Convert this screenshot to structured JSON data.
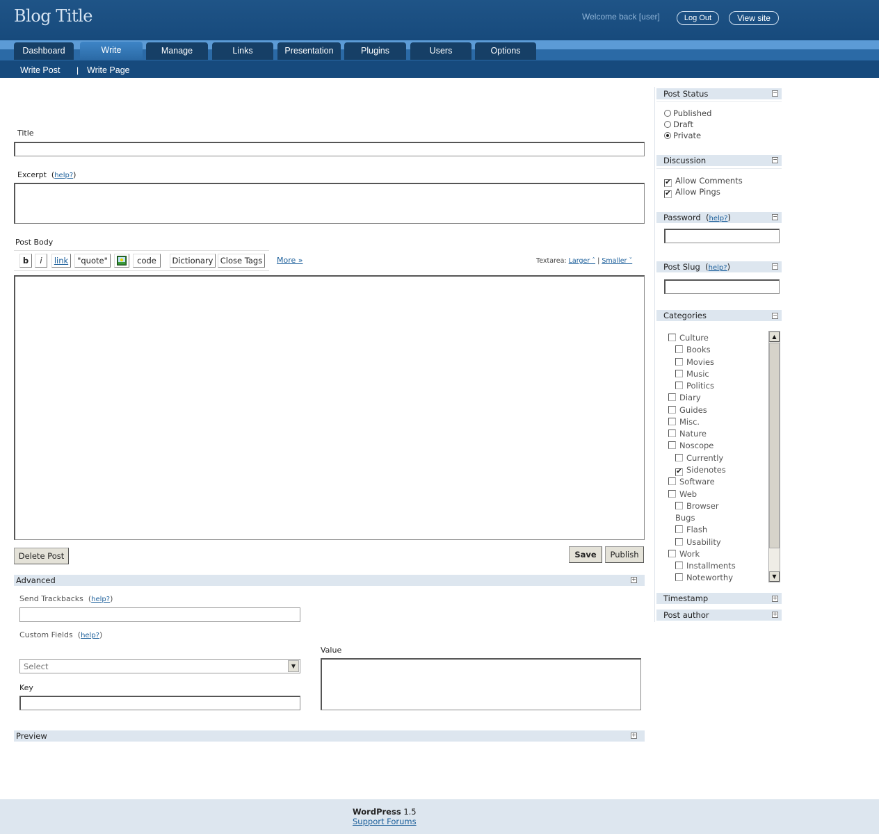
{
  "header": {
    "blog_title": "Blog Title",
    "welcome": "Welcome back [user]",
    "logout": "Log Out",
    "view_site": "View site"
  },
  "tabs": [
    {
      "label": "Dashboard",
      "active": false
    },
    {
      "label": "Write",
      "active": true
    },
    {
      "label": "Manage",
      "active": false
    },
    {
      "label": "Links",
      "active": false
    },
    {
      "label": "Presentation",
      "active": false
    },
    {
      "label": "Plugins",
      "active": false
    },
    {
      "label": "Users",
      "active": false
    },
    {
      "label": "Options",
      "active": false
    }
  ],
  "subtabs": {
    "write_post": "Write Post",
    "separator": "|",
    "write_page": "Write Page"
  },
  "form": {
    "title_label": "Title",
    "title_value": "",
    "excerpt_label": "Excerpt",
    "help": "help?",
    "post_body_label": "Post Body",
    "quicktags": [
      "b",
      "i",
      "link",
      "\"quote\"",
      "code",
      "Dictionary",
      "Close Tags"
    ],
    "image_icon": "image-icon",
    "more": "More »",
    "textarea_label": "Textarea:",
    "larger": "Larger ˆ",
    "smaller": "Smaller ˇ",
    "text_sep": "|",
    "delete_post": "Delete Post",
    "save": "Save",
    "publish": "Publish"
  },
  "advanced": {
    "title": "Advanced",
    "send_trackbacks": "Send Trackbacks",
    "custom_fields": "Custom Fields",
    "select_placeholder": "Select",
    "key": "Key",
    "value": "Value"
  },
  "preview": {
    "title": "Preview"
  },
  "sidebar": {
    "post_status": {
      "title": "Post Status",
      "options": [
        {
          "label": "Published",
          "checked": false
        },
        {
          "label": "Draft",
          "checked": false
        },
        {
          "label": "Private",
          "checked": true
        }
      ]
    },
    "discussion": {
      "title": "Discussion",
      "options": [
        {
          "label": "Allow Comments",
          "checked": true
        },
        {
          "label": "Allow Pings",
          "checked": true
        }
      ]
    },
    "password": {
      "title": "Password",
      "value": ""
    },
    "post_slug": {
      "title": "Post Slug",
      "value": ""
    },
    "categories": {
      "title": "Categories",
      "items": [
        {
          "label": "Culture",
          "level": 0,
          "checked": false,
          "checkbox": true
        },
        {
          "label": "Books",
          "level": 1,
          "checked": false,
          "checkbox": true
        },
        {
          "label": "Movies",
          "level": 1,
          "checked": false,
          "checkbox": true
        },
        {
          "label": "Music",
          "level": 1,
          "checked": false,
          "checkbox": true
        },
        {
          "label": "Politics",
          "level": 1,
          "checked": false,
          "checkbox": true
        },
        {
          "label": "Diary",
          "level": 0,
          "checked": false,
          "checkbox": true
        },
        {
          "label": "Guides",
          "level": 0,
          "checked": false,
          "checkbox": true
        },
        {
          "label": "Misc.",
          "level": 0,
          "checked": false,
          "checkbox": true
        },
        {
          "label": "Nature",
          "level": 0,
          "checked": false,
          "checkbox": true
        },
        {
          "label": "Noscope",
          "level": 0,
          "checked": false,
          "checkbox": true
        },
        {
          "label": "Currently",
          "level": 1,
          "checked": false,
          "checkbox": true
        },
        {
          "label": "Sidenotes",
          "level": 1,
          "checked": true,
          "checkbox": true
        },
        {
          "label": "Software",
          "level": 0,
          "checked": false,
          "checkbox": true
        },
        {
          "label": "Web",
          "level": 0,
          "checked": false,
          "checkbox": true
        },
        {
          "label": "Browser",
          "level": 1,
          "checked": false,
          "checkbox": true
        },
        {
          "label": "Bugs",
          "level": 1,
          "checked": false,
          "checkbox": false
        },
        {
          "label": "Flash",
          "level": 1,
          "checked": false,
          "checkbox": true
        },
        {
          "label": "Usability",
          "level": 1,
          "checked": false,
          "checkbox": true
        },
        {
          "label": "Work",
          "level": 0,
          "checked": false,
          "checkbox": true
        },
        {
          "label": "Installments",
          "level": 1,
          "checked": false,
          "checkbox": true
        },
        {
          "label": "Noteworthy",
          "level": 1,
          "checked": false,
          "checkbox": true
        }
      ]
    },
    "timestamp": {
      "title": "Timestamp"
    },
    "post_author": {
      "title": "Post author"
    }
  },
  "footer": {
    "version_name": "WordPress",
    "version_number": "1.5",
    "support": "Support Forums"
  }
}
